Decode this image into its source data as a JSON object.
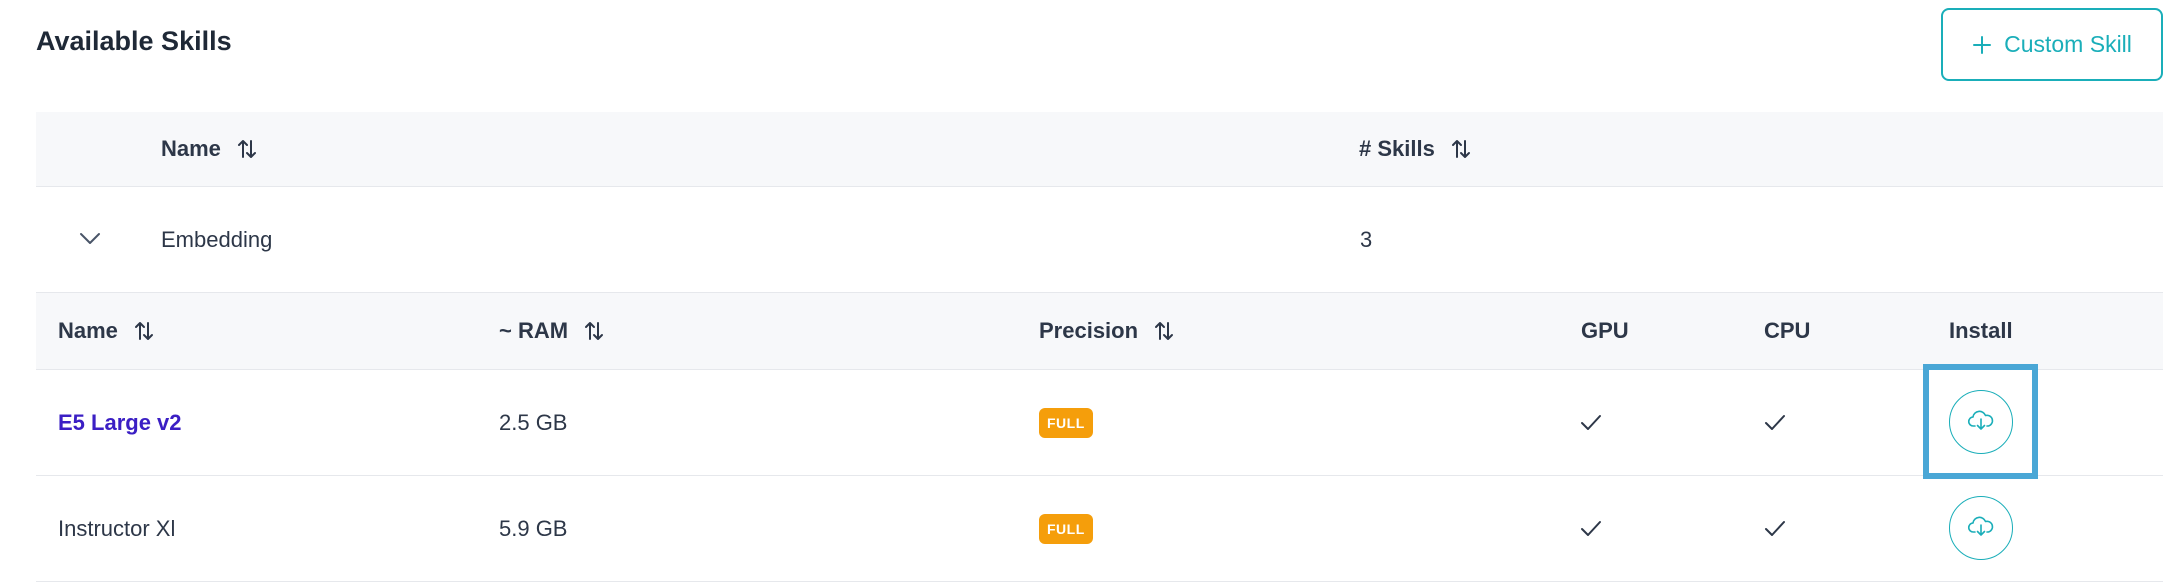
{
  "page": {
    "title": "Available Skills",
    "custom_skill_button": "Custom Skill"
  },
  "group_table": {
    "columns": [
      "Name",
      "# Skills"
    ],
    "groups": [
      {
        "name": "Embedding",
        "skills_count": "3",
        "expanded": true
      }
    ]
  },
  "skills_table": {
    "columns": [
      "Name",
      "~ RAM",
      "Precision",
      "GPU",
      "CPU",
      "Install"
    ],
    "rows": [
      {
        "name": "E5 Large v2",
        "ram": "2.5 GB",
        "precision": "FULL",
        "gpu": true,
        "cpu": true
      },
      {
        "name": "Instructor Xl",
        "ram": "5.9 GB",
        "precision": "FULL",
        "gpu": true,
        "cpu": true
      }
    ]
  },
  "icons": {
    "add": "plus-icon",
    "sort": "sort-arrows-icon",
    "expand": "chevron-down-icon",
    "check": "check-icon",
    "install": "cloud-download-icon"
  },
  "colors": {
    "accent": "#1aaeb9",
    "link": "#3b1fc4",
    "badge": "#f59e0b",
    "header_bg": "#f7f8fa",
    "highlight": "#4aa7d6"
  }
}
